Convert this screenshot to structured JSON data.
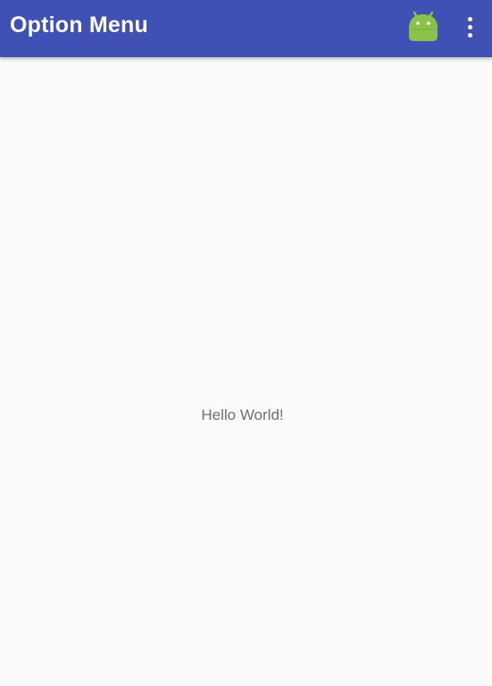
{
  "toolbar": {
    "title": "Option Menu",
    "background_color": "#3f51b5",
    "actions": [
      {
        "icon": "android-icon",
        "color": "#8bc34a"
      },
      {
        "icon": "overflow-menu-icon",
        "color": "#ffffff"
      }
    ]
  },
  "main": {
    "text": "Hello World!",
    "background_color": "#fafafa"
  }
}
